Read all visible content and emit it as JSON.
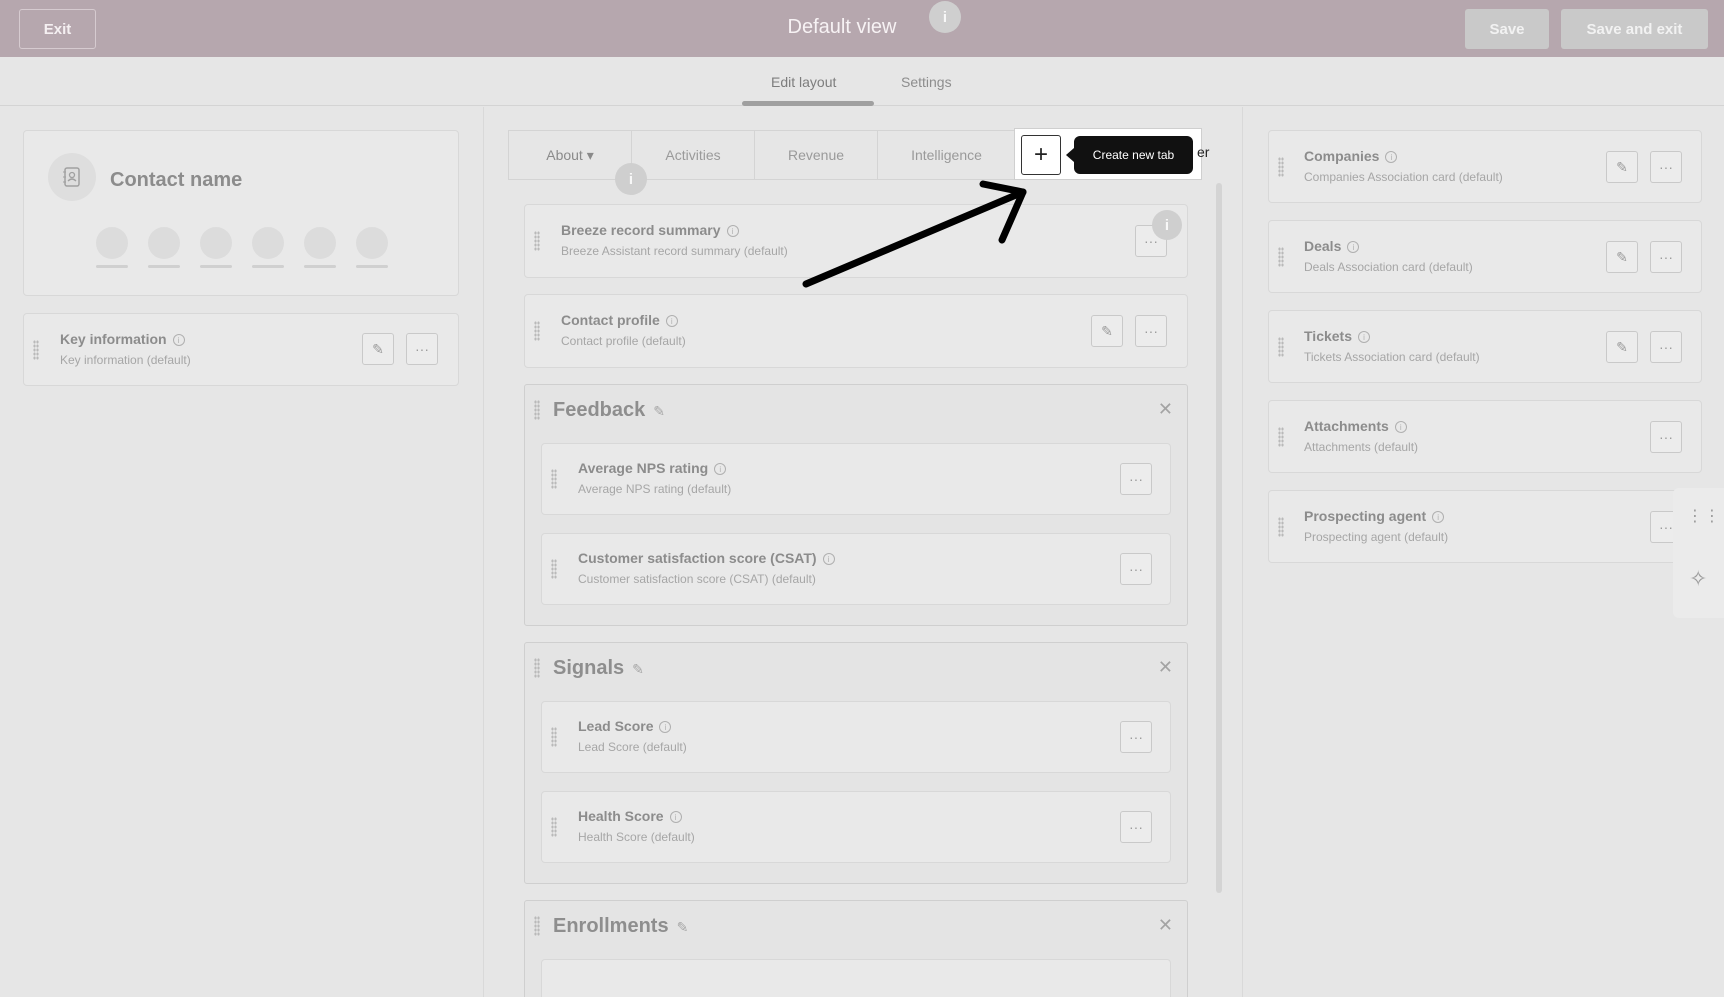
{
  "header": {
    "exit_label": "Exit",
    "title": "Default view",
    "info_glyph": "i",
    "save_label": "Save",
    "save_exit_label": "Save and exit"
  },
  "subnav": {
    "tabs": [
      {
        "label": "Edit layout",
        "active": true
      },
      {
        "label": "Settings",
        "active": false
      }
    ]
  },
  "left": {
    "contact_name": "Contact name",
    "contact_icon": "contact-book-icon",
    "key_info": {
      "title": "Key information",
      "subtitle": "Key information (default)"
    }
  },
  "middle": {
    "tabs": [
      "About ▾",
      "Activities",
      "Revenue",
      "Intelligence"
    ],
    "tab_overflow": "er",
    "new_tab_tooltip": "Create new tab",
    "plus_glyph": "+",
    "cards": [
      {
        "title": "Breeze record summary",
        "subtitle": "Breeze Assistant record summary (default)"
      },
      {
        "title": "Contact profile",
        "subtitle": "Contact profile (default)"
      }
    ],
    "groups": [
      {
        "title": "Feedback",
        "cards": [
          {
            "title": "Average NPS rating",
            "subtitle": "Average NPS rating (default)"
          },
          {
            "title": "Customer satisfaction score (CSAT)",
            "subtitle": "Customer satisfaction score (CSAT) (default)"
          }
        ]
      },
      {
        "title": "Signals",
        "cards": [
          {
            "title": "Lead Score",
            "subtitle": "Lead Score (default)"
          },
          {
            "title": "Health Score",
            "subtitle": "Health Score (default)"
          }
        ]
      },
      {
        "title": "Enrollments",
        "cards": []
      }
    ]
  },
  "right": {
    "cards": [
      {
        "title": "Companies",
        "subtitle": "Companies Association card (default)"
      },
      {
        "title": "Deals",
        "subtitle": "Deals Association card (default)"
      },
      {
        "title": "Tickets",
        "subtitle": "Tickets Association card (default)"
      },
      {
        "title": "Attachments",
        "subtitle": "Attachments (default)"
      },
      {
        "title": "Prospecting agent",
        "subtitle": "Prospecting agent (default)"
      }
    ]
  },
  "glyphs": {
    "more": "···",
    "edit": "✎",
    "close": "✕",
    "grid": "⋮⋮",
    "sparkle": "✧"
  },
  "colors": {
    "header_bg": "#b6a7ae",
    "overlay_bg": "#e6e6e6",
    "tooltip_bg": "#111111"
  }
}
